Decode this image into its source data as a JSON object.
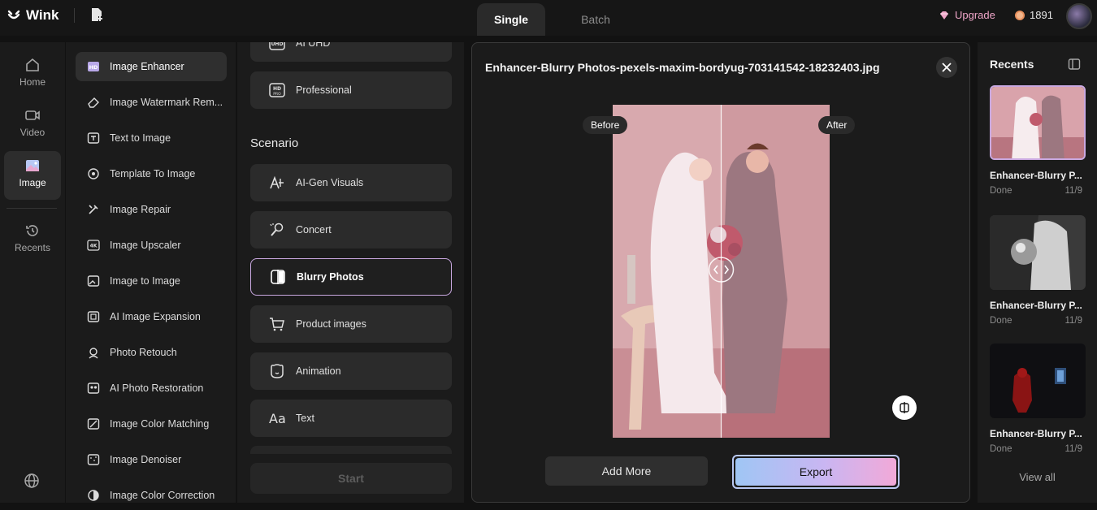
{
  "app": {
    "name": "Wink"
  },
  "header": {
    "tabs": [
      {
        "label": "Single",
        "active": true
      },
      {
        "label": "Batch",
        "active": false
      }
    ],
    "upgrade_label": "Upgrade",
    "coins": "1891"
  },
  "nav": {
    "items": [
      {
        "label": "Home",
        "icon": "home-icon"
      },
      {
        "label": "Video",
        "icon": "video-icon"
      },
      {
        "label": "Image",
        "icon": "image-icon",
        "active": true
      },
      {
        "label": "Recents",
        "icon": "history-icon"
      }
    ]
  },
  "tools": {
    "items": [
      {
        "label": "Image Enhancer",
        "active": true
      },
      {
        "label": "Image Watermark Rem..."
      },
      {
        "label": "Text to Image"
      },
      {
        "label": "Template To Image"
      },
      {
        "label": "Image Repair"
      },
      {
        "label": "Image Upscaler"
      },
      {
        "label": "Image to Image"
      },
      {
        "label": "AI Image Expansion"
      },
      {
        "label": "Photo Retouch"
      },
      {
        "label": "AI Photo Restoration"
      },
      {
        "label": "Image Color Matching"
      },
      {
        "label": "Image Denoiser"
      },
      {
        "label": "Image Color Correction"
      }
    ]
  },
  "options": {
    "quality": [
      {
        "label": "AI UHD"
      },
      {
        "label": "Professional"
      }
    ],
    "scenario_title": "Scenario",
    "scenarios": [
      {
        "label": "AI-Gen Visuals"
      },
      {
        "label": "Concert"
      },
      {
        "label": "Blurry Photos",
        "active": true
      },
      {
        "label": "Product images"
      },
      {
        "label": "Animation"
      },
      {
        "label": "Text"
      }
    ],
    "start_label": "Start"
  },
  "preview": {
    "filename": "Enhancer-Blurry Photos-pexels-maxim-bordyug-703141542-18232403.jpg",
    "before_label": "Before",
    "after_label": "After",
    "add_more_label": "Add More",
    "export_label": "Export"
  },
  "recents": {
    "title": "Recents",
    "items": [
      {
        "name": "Enhancer-Blurry P...",
        "status": "Done",
        "date": "11/9"
      },
      {
        "name": "Enhancer-Blurry P...",
        "status": "Done",
        "date": "11/9"
      },
      {
        "name": "Enhancer-Blurry P...",
        "status": "Done",
        "date": "11/9"
      }
    ],
    "view_all_label": "View all"
  },
  "colors": {
    "accent_border": "#c9a8e0",
    "upgrade": "#f0a6c9",
    "export_gradient_start": "#9fc6f4",
    "export_gradient_end": "#f2a9d8"
  }
}
